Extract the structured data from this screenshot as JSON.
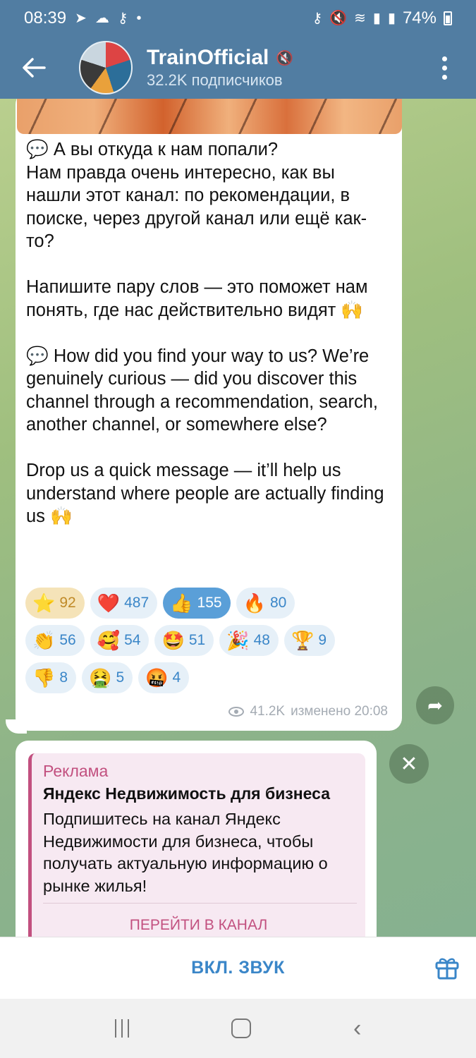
{
  "status_bar": {
    "time": "08:39",
    "battery": "74%"
  },
  "header": {
    "back_icon": "arrow-left-icon",
    "channel_name": "TrainOfficial",
    "subscribers": "32.2K подписчиков"
  },
  "post": {
    "text_ru_1": "💬 А вы откуда к нам попали?\nНам правда очень интересно, как вы нашли этот канал: по рекомендации, в поиске, через другой канал или ещё как-то?",
    "text_ru_2": "Напишите пару слов — это поможет нам понять, где нас действительно видят 🙌",
    "text_en_1": "💬 How did you find your way to us? We’re genuinely curious — did you discover this channel through a recommendation, search, another channel, or somewhere else?",
    "text_en_2": "Drop us a quick message — it’ll help us understand where people are actually finding us 🙌",
    "reactions": [
      {
        "emoji": "⭐",
        "count": "92"
      },
      {
        "emoji": "❤️",
        "count": "487"
      },
      {
        "emoji": "👍",
        "count": "155"
      },
      {
        "emoji": "🔥",
        "count": "80"
      },
      {
        "emoji": "👏",
        "count": "56"
      },
      {
        "emoji": "🥰",
        "count": "54"
      },
      {
        "emoji": "🤩",
        "count": "51"
      },
      {
        "emoji": "🎉",
        "count": "48"
      },
      {
        "emoji": "🏆",
        "count": "9"
      },
      {
        "emoji": "👎",
        "count": "8"
      },
      {
        "emoji": "🤮",
        "count": "5"
      },
      {
        "emoji": "🤬",
        "count": "4"
      }
    ],
    "views": "41.2K",
    "edited": "изменено 20:08"
  },
  "ad": {
    "label": "Реклама",
    "title": "Яндекс Недвижимость для бизнеса",
    "text": "Подпишитесь на канал Яндекс Недвижимости для бизнеса, чтобы получать актуальную информацию о рынке жилья!",
    "cta": "ПЕРЕЙТИ В КАНАЛ"
  },
  "bottom_bar": {
    "unmute_label": "ВКЛ. ЗВУК"
  },
  "colors": {
    "header_bg": "#517da2",
    "accent": "#3a86c8",
    "ad_accent": "#c2507f"
  }
}
